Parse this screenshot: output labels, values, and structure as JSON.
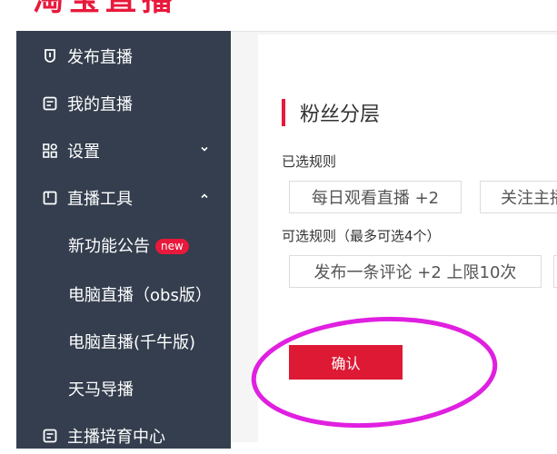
{
  "logo": {
    "text": "淘宝直播"
  },
  "sidebar": {
    "items": [
      {
        "label": "发布直播",
        "icon": "shield-pin-icon"
      },
      {
        "label": "我的直播",
        "icon": "document-icon"
      },
      {
        "label": "设置",
        "icon": "grid-settings-icon",
        "expanded": false
      },
      {
        "label": "直播工具",
        "icon": "window-icon",
        "expanded": true
      },
      {
        "label": "新功能公告",
        "badge": "new"
      },
      {
        "label": "电脑直播（obs版）"
      },
      {
        "label": "电脑直播(千牛版)"
      },
      {
        "label": "天马导播"
      },
      {
        "label": "主播培育中心",
        "icon": "document-icon"
      }
    ]
  },
  "main": {
    "section_title": "粉丝分层",
    "selected_rules_label": "已选规则",
    "selected_rules": [
      "每日观看直播 +2",
      "关注主播"
    ],
    "available_rules_label": "可选规则（最多可选4个）",
    "available_rules": [
      "发布一条评论 +2 上限10次"
    ],
    "confirm_label": "确认"
  },
  "colors": {
    "sidebar_bg": "#343e4e",
    "accent_red": "#e8193c",
    "annotation_ellipse": "#e020e0"
  }
}
